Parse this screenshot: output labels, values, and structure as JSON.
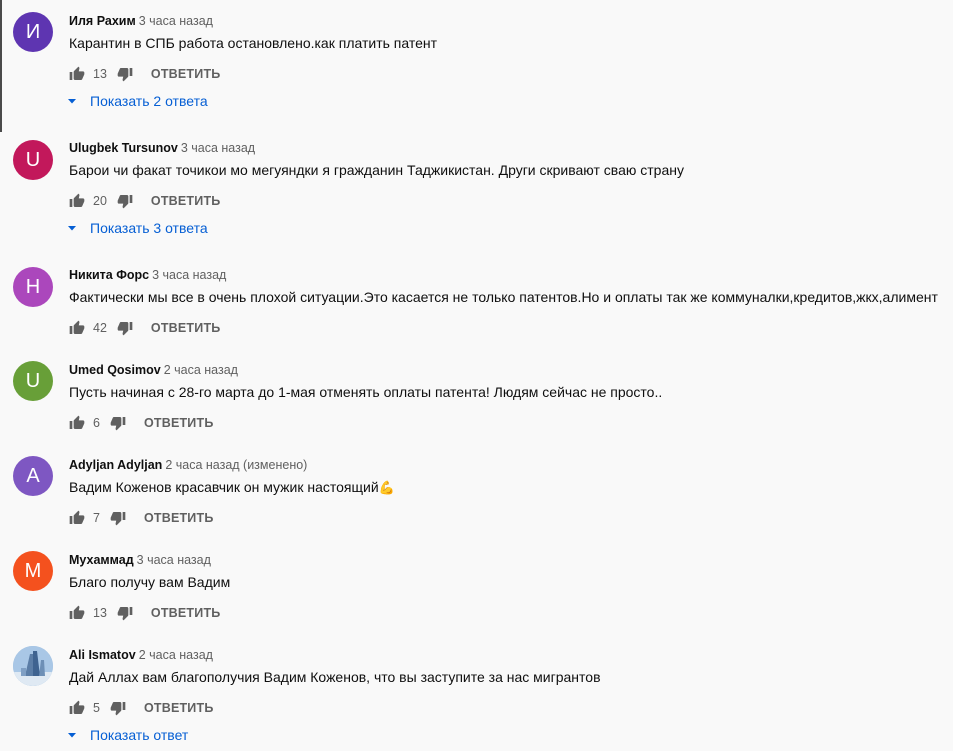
{
  "comments": [
    {
      "avatar_letter": "И",
      "avatar_color": "#5e35b1",
      "author": "Иля Рахим",
      "time": "3 часа назад",
      "text": "Карантин в СПБ работа остановлено.как платить патент",
      "likes": "13",
      "reply_label": "ОТВЕТИТЬ",
      "replies_label": "Показать 2 ответа"
    },
    {
      "avatar_letter": "U",
      "avatar_color": "#c2185b",
      "author": "Ulugbek Tursunov",
      "time": "3 часа назад",
      "text": "Барои чи факат точикои мо мегуяндки я гражданин Таджикистан. Други скривают сваю страну",
      "likes": "20",
      "reply_label": "ОТВЕТИТЬ",
      "replies_label": "Показать 3 ответа"
    },
    {
      "avatar_letter": "Н",
      "avatar_color": "#ab47bc",
      "author": "Никита Форс",
      "time": "3 часа назад",
      "text": "Фактически мы все в очень плохой ситуации.Это касается не только патентов.Но и оплаты так же коммуналки,кредитов,жкх,алимент",
      "likes": "42",
      "reply_label": "ОТВЕТИТЬ"
    },
    {
      "avatar_letter": "U",
      "avatar_color": "#689f38",
      "author": "Umed Qosimov",
      "time": "2 часа назад",
      "text": "Пусть начиная с 28-го марта до 1-мая отменять оплаты патента! Людям сейчас не просто..",
      "likes": "6",
      "reply_label": "ОТВЕТИТЬ"
    },
    {
      "avatar_letter": "A",
      "avatar_color": "#7e57c2",
      "author": "Adyljan Adyljan",
      "time": "2 часа назад (изменено)",
      "text": "Вадим Коженов красавчик он мужик настоящий",
      "emoji": "💪",
      "likes": "7",
      "reply_label": "ОТВЕТИТЬ"
    },
    {
      "avatar_letter": "М",
      "avatar_color": "#f4511e",
      "author": "Мухаммад",
      "time": "3 часа назад",
      "text": "Благо получу вам Вадим",
      "likes": "13",
      "reply_label": "ОТВЕТИТЬ"
    },
    {
      "avatar_letter": "",
      "avatar_color": "#8fb4d8",
      "author": "Ali Ismatov",
      "time": "2 часа назад",
      "text": "Дай Аллах вам благополучия Вадим Коженов, что вы заступите за нас мигрантов",
      "likes": "5",
      "reply_label": "ОТВЕТИТЬ",
      "replies_label": "Показать ответ"
    }
  ]
}
